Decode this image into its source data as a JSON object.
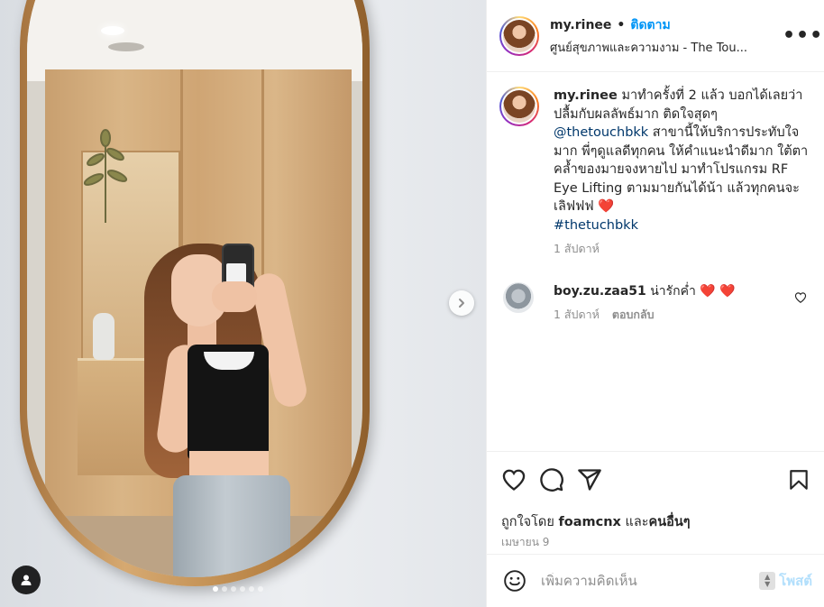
{
  "post": {
    "username": "my.rinee",
    "separator": "•",
    "follow_label": "ติดตาม",
    "location": "ศูนย์สุขภาพและความงาม - The Tou...",
    "more_label": "•••"
  },
  "caption": {
    "username": "my.rinee",
    "text_part1": " มาทำครั้งที่ 2 แล้ว บอกได้เลยว่าปลื้มกับผลลัพธ์มาก ติดใจสุดๆ ",
    "mention": "@thetouchbkk",
    "text_part2": " สาขานี้ให้บริการประทับใจมาก พี่ๆดูแลดีทุกคน ให้คำแนะนำดีมาก ใต้ตาคล้ำของมายจงหายไป มาทำโปรแกรม RF Eye Lifting ตามมายกันได้น้า แล้วทุกคนจะเลิฟฟฟ ",
    "heart": "❤️",
    "hashtag": "#thetuchbkk",
    "time": "1 สัปดาห์"
  },
  "comments": [
    {
      "username": "boy.zu.zaa51",
      "text": " น่ารักค่ำ ",
      "hearts": "❤️ ❤️",
      "time": "1 สัปดาห์",
      "reply_label": "ตอบกลับ"
    }
  ],
  "likes": {
    "prefix": "ถูกใจโดย ",
    "user": "foamcnx",
    "middle": " และ",
    "others": "คนอื่นๆ"
  },
  "date": "เมษายน 9",
  "add_comment": {
    "placeholder": "เพิ่มความคิดเห็น",
    "post_label": "โพสต์"
  },
  "carousel": {
    "total": 6,
    "active": 1
  },
  "colors": {
    "accent": "#0095f6",
    "mention": "#00376b",
    "heart": "#ed1c3c",
    "muted": "#8e8e8e",
    "post_disabled": "#b2dffc"
  }
}
